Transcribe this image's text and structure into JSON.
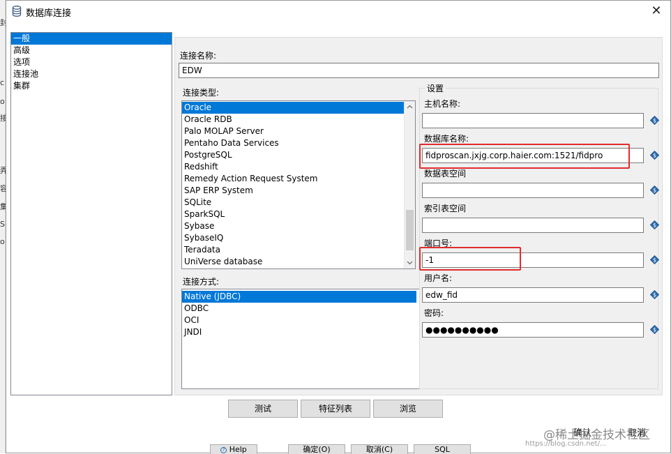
{
  "window": {
    "title": "数据库连接",
    "close_glyph": "✕",
    "icon": "database-icon"
  },
  "background_fragments": [
    "封",
    "c",
    "o",
    "接",
    "",
    "#",
    "",
    "弄",
    "容",
    "集",
    "S",
    "o"
  ],
  "nav": {
    "items": [
      {
        "label": "一般",
        "selected": true
      },
      {
        "label": "高级",
        "selected": false
      },
      {
        "label": "选项",
        "selected": false
      },
      {
        "label": "连接池",
        "selected": false
      },
      {
        "label": "集群",
        "selected": false
      }
    ]
  },
  "connection_name": {
    "label": "连接名称:",
    "value": "EDW"
  },
  "connection_type": {
    "label": "连接类型:",
    "items": [
      {
        "label": "Oracle",
        "selected": true
      },
      {
        "label": "Oracle RDB",
        "selected": false
      },
      {
        "label": "Palo MOLAP Server",
        "selected": false
      },
      {
        "label": "Pentaho Data Services",
        "selected": false
      },
      {
        "label": "PostgreSQL",
        "selected": false
      },
      {
        "label": "Redshift",
        "selected": false
      },
      {
        "label": "Remedy Action Request System",
        "selected": false
      },
      {
        "label": "SAP ERP System",
        "selected": false
      },
      {
        "label": "SQLite",
        "selected": false
      },
      {
        "label": "SparkSQL",
        "selected": false
      },
      {
        "label": "Sybase",
        "selected": false
      },
      {
        "label": "SybaseIQ",
        "selected": false
      },
      {
        "label": "Teradata",
        "selected": false
      },
      {
        "label": "UniVerse database",
        "selected": false
      }
    ]
  },
  "access_method": {
    "label": "连接方式:",
    "items": [
      {
        "label": "Native (JDBC)",
        "selected": true
      },
      {
        "label": "ODBC",
        "selected": false
      },
      {
        "label": "OCI",
        "selected": false
      },
      {
        "label": "JNDI",
        "selected": false
      }
    ]
  },
  "settings": {
    "title": "设置",
    "fields": [
      {
        "key": "host",
        "label": "主机名称:",
        "value": ""
      },
      {
        "key": "database",
        "label": "数据库名称:",
        "value": "fidproscan.jxjg.corp.haier.com:1521/fidpro"
      },
      {
        "key": "tablespace",
        "label": "数据表空间",
        "value": ""
      },
      {
        "key": "index-tablespace",
        "label": "索引表空间",
        "value": ""
      },
      {
        "key": "port",
        "label": "端口号:",
        "value": "-1"
      },
      {
        "key": "username",
        "label": "用户名:",
        "value": "edw_fid"
      },
      {
        "key": "password",
        "label": "密码:",
        "value": "●●●●●●●●●●"
      }
    ]
  },
  "buttons": {
    "test": "测试",
    "features": "特征列表",
    "explore": "浏览",
    "ok": "确认",
    "cancel": "取消"
  },
  "footer": {
    "items": [
      "Help",
      "确定(O)",
      "取消(C)",
      "SQL"
    ]
  },
  "watermark": {
    "line1": "@稀土掘金技术社区",
    "line2": "https://blog.csdn.net/..."
  },
  "colors": {
    "selection": "#0078d7",
    "highlight_box": "#e22b2b",
    "variable_icon": "#2b6cb0"
  }
}
